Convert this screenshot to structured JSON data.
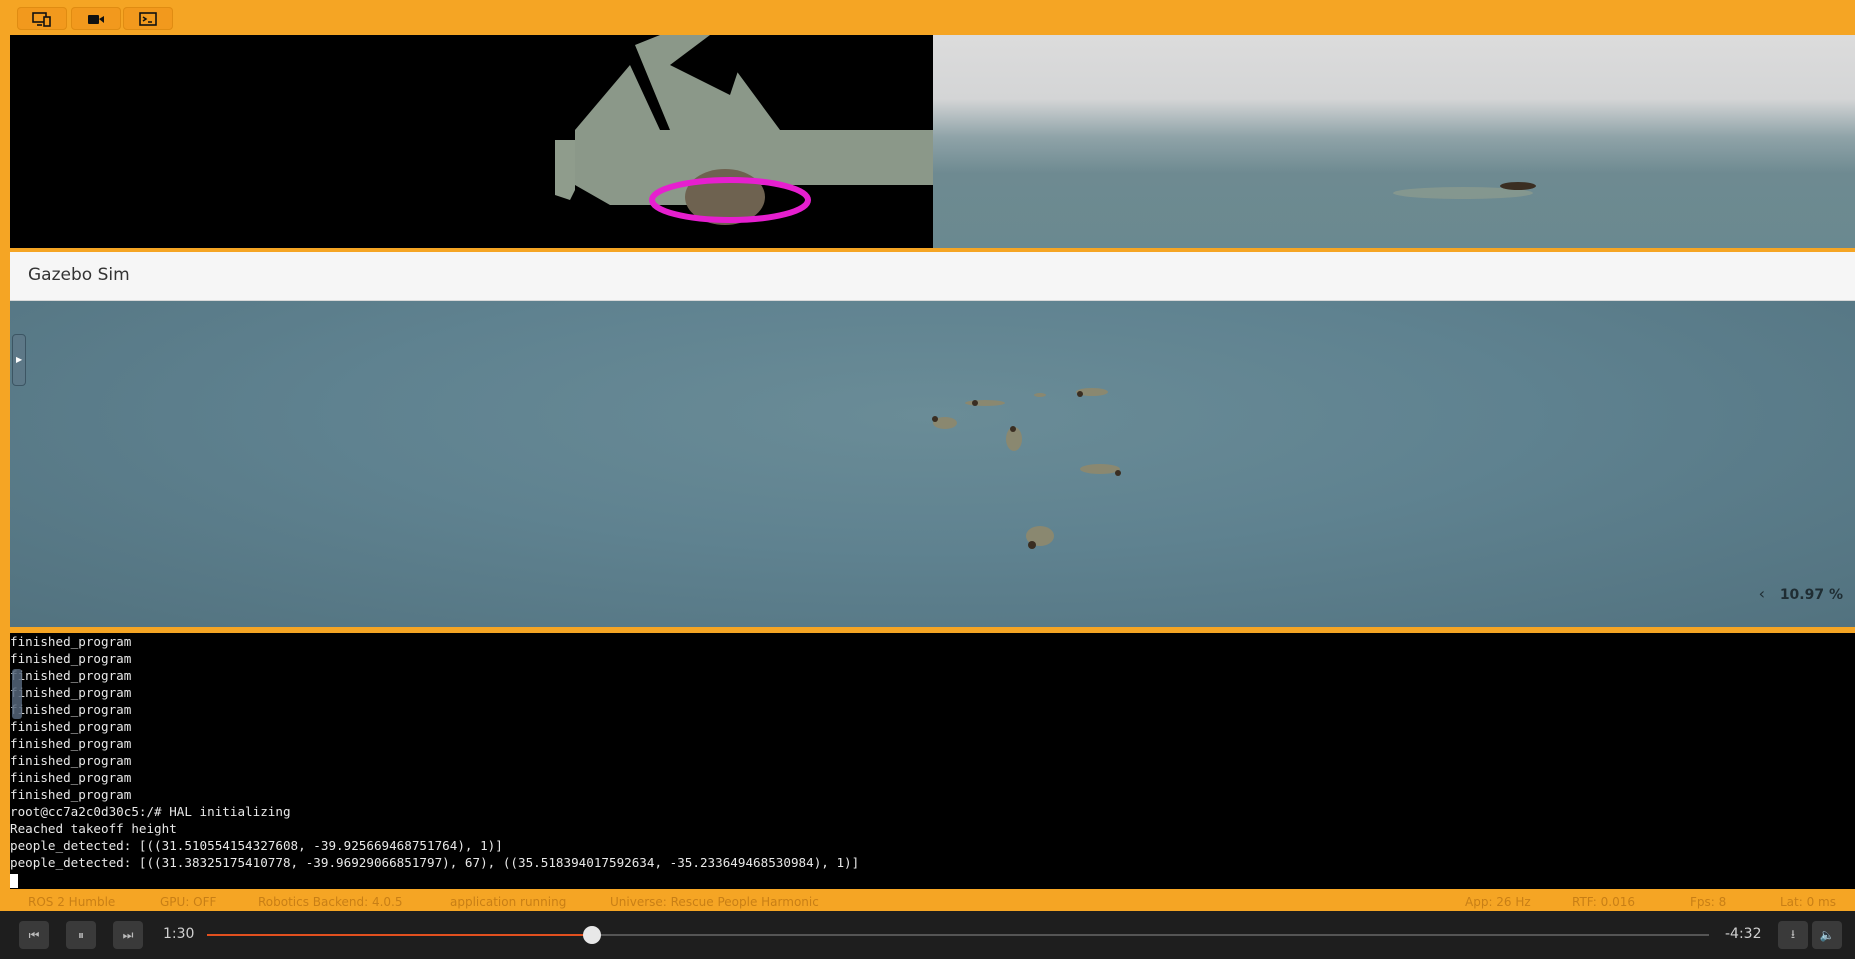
{
  "toolbar": {
    "buttons": [
      {
        "name": "screen-icon"
      },
      {
        "name": "camera-icon"
      },
      {
        "name": "terminal-icon"
      }
    ]
  },
  "gazebo": {
    "title": "Gazebo Sim",
    "rtf": "10.97 %",
    "rtf_toggle": "‹"
  },
  "terminal": {
    "lines": [
      "finished_program",
      "finished_program",
      "finished_program",
      "finished_program",
      "finished_program",
      "finished_program",
      "finished_program",
      "finished_program",
      "finished_program",
      "finished_program",
      "root@cc7a2c0d30c5:/# HAL initializing",
      "Reached takeoff height",
      "people_detected: [((31.510554154327608, -39.925669468751764), 1)]",
      "people_detected: [((31.38325175410778, -39.96929066851797), 67), ((35.518394017592634, -35.233649468530984), 1)]"
    ]
  },
  "statusbar": {
    "items": [
      "ROS 2 Humble",
      "GPU: OFF",
      "Robotics Backend: 4.0.5",
      "application running",
      "Universe: Rescue People Harmonic",
      "App: 26 Hz",
      "RTF: 0.016",
      "Fps: 8",
      "Lat: 0 ms"
    ]
  },
  "player": {
    "current_time": "1:30",
    "remaining_time": "-4:32",
    "progress": 0.2564
  }
}
